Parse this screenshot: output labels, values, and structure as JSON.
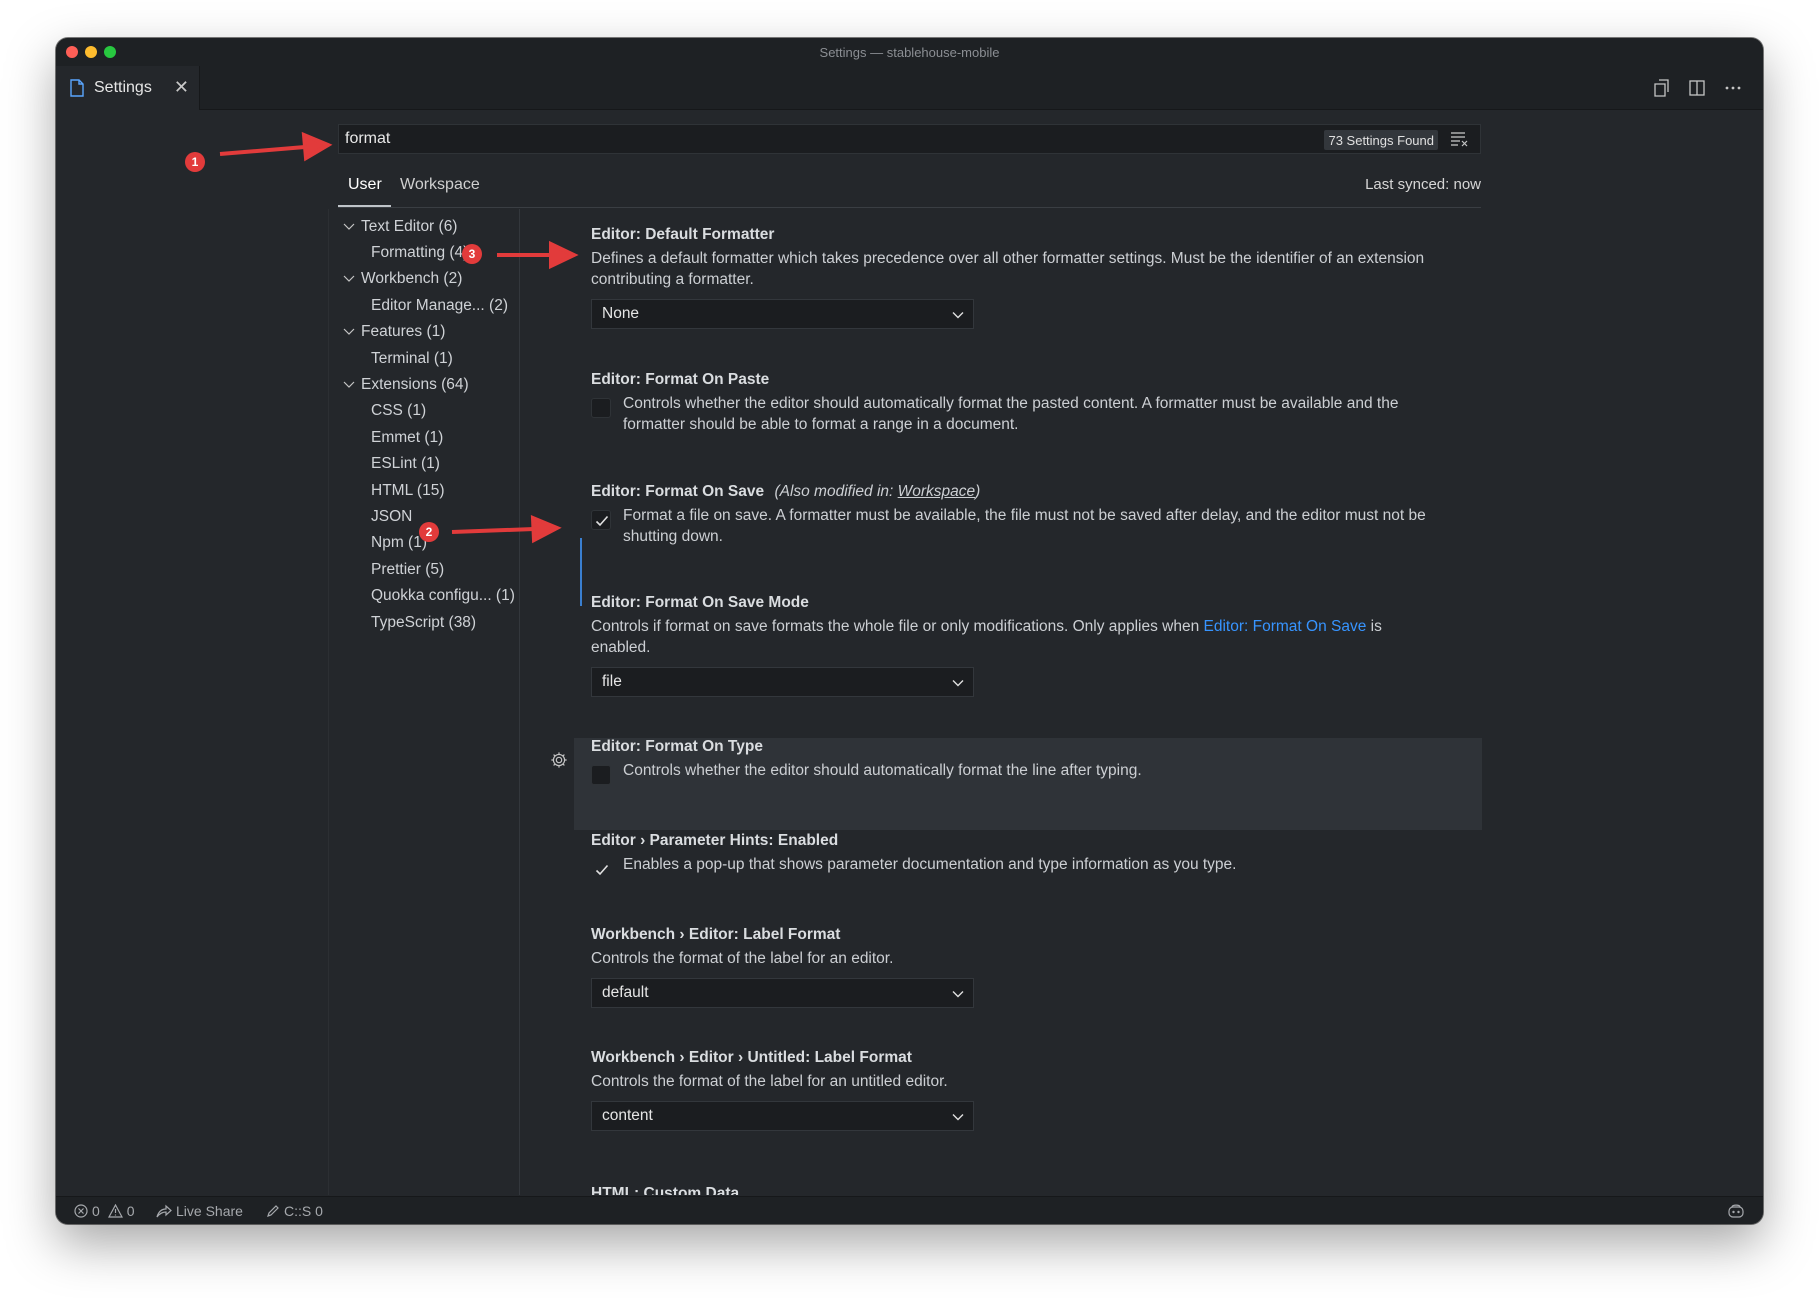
{
  "window": {
    "title": "Settings — stablehouse-mobile"
  },
  "tab": {
    "label": "Settings",
    "close": "✕"
  },
  "search": {
    "value": "format",
    "found": "73 Settings Found"
  },
  "scope": {
    "user": "User",
    "workspace": "Workspace",
    "synced": "Last synced: now"
  },
  "toc": [
    {
      "label": "Text Editor (6)",
      "level": 0
    },
    {
      "label": "Formatting (4)",
      "level": 1
    },
    {
      "label": "Workbench (2)",
      "level": 0
    },
    {
      "label": "Editor Manage...   (2)",
      "level": 1
    },
    {
      "label": "Features (1)",
      "level": 0
    },
    {
      "label": "Terminal (1)",
      "level": 1
    },
    {
      "label": "Extensions (64)",
      "level": 0
    },
    {
      "label": "CSS (1)",
      "level": 1
    },
    {
      "label": "Emmet (1)",
      "level": 1
    },
    {
      "label": "ESLint (1)",
      "level": 1
    },
    {
      "label": "HTML (15)",
      "level": 1
    },
    {
      "label": "JSON",
      "level": 1
    },
    {
      "label": "Npm (1)",
      "level": 1
    },
    {
      "label": "Prettier (5)",
      "level": 1
    },
    {
      "label": "Quokka configu...  (1)",
      "level": 1
    },
    {
      "label": "TypeScript (38)",
      "level": 1
    }
  ],
  "settings": {
    "default_formatter": {
      "title": "Editor: Default Formatter",
      "desc1": "Defines a default formatter which takes precedence over all other formatter settings. Must be the identifier of an extension",
      "desc2": "contributing a formatter.",
      "value": "None"
    },
    "format_on_paste": {
      "title": "Editor: Format On Paste",
      "desc1": "Controls whether the editor should automatically format the pasted content. A formatter must be available and the",
      "desc2": "formatter should be able to format a range in a document."
    },
    "format_on_save": {
      "title": "Editor: Format On Save",
      "modified_prefix": "(Also modified in: ",
      "modified_link": "Workspace",
      "modified_suffix": ")",
      "desc1": "Format a file on save. A formatter must be available, the file must not be saved after delay, and the editor must not be",
      "desc2": "shutting down."
    },
    "format_on_save_mode": {
      "title": "Editor: Format On Save Mode",
      "desc1_a": "Controls if format on save formats the whole file or only modifications. Only applies when ",
      "desc1_link": "Editor: Format On Save",
      "desc1_b": " is",
      "desc2": "enabled.",
      "value": "file"
    },
    "format_on_type": {
      "title": "Editor: Format On Type",
      "desc": "Controls whether the editor should automatically format the line after typing."
    },
    "parameter_hints": {
      "category": "Editor › Parameter Hints: ",
      "name": "Enabled",
      "desc": "Enables a pop-up that shows parameter documentation and type information as you type."
    },
    "label_format": {
      "category": "Workbench › Editor: ",
      "name": "Label Format",
      "desc": "Controls the format of the label for an editor.",
      "value": "default"
    },
    "untitled_label_format": {
      "category": "Workbench › Editor › Untitled: ",
      "name": "Label Format",
      "desc": "Controls the format of the label for an untitled editor.",
      "value": "content"
    },
    "html_custom_data": {
      "title": "HTML: Custom Data"
    }
  },
  "annotations": [
    "1",
    "2",
    "3"
  ],
  "statusbar": {
    "errors": "0",
    "warnings": "0",
    "live_share": "Live Share",
    "cs": "C::S 0"
  },
  "colors": {
    "accent": "#3794ff",
    "annotation": "#e23b3b",
    "background": "#24272b"
  }
}
